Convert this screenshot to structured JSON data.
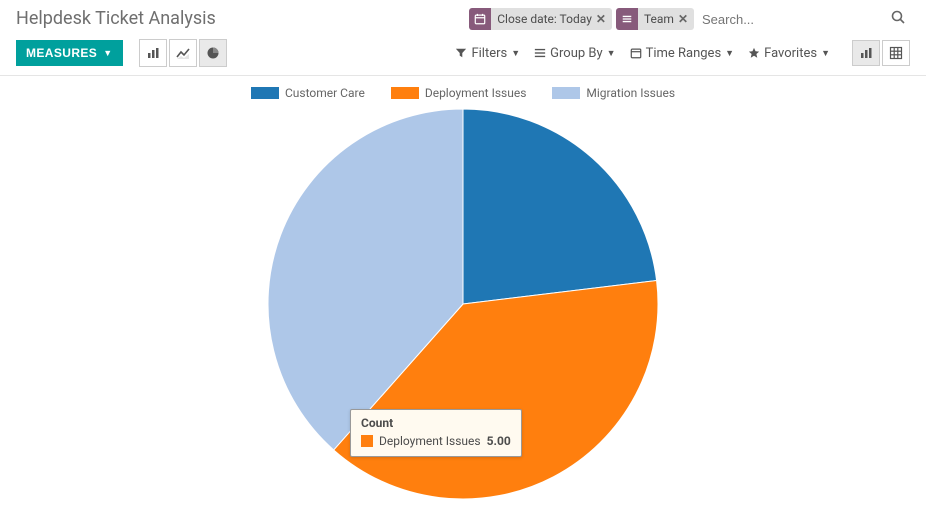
{
  "header": {
    "title": "Helpdesk Ticket Analysis"
  },
  "search": {
    "facets": [
      {
        "icon": "calendar",
        "label": "Close date: Today"
      },
      {
        "icon": "list",
        "label": "Team"
      }
    ],
    "placeholder": "Search..."
  },
  "toolbar": {
    "measures_label": "MEASURES",
    "filters_label": "Filters",
    "groupby_label": "Group By",
    "timeranges_label": "Time Ranges",
    "favorites_label": "Favorites"
  },
  "legend": {
    "items": [
      {
        "label": "Customer Care",
        "color": "#1f77b4"
      },
      {
        "label": "Deployment Issues",
        "color": "#ff7f0e"
      },
      {
        "label": "Migration Issues",
        "color": "#aec7e8"
      }
    ]
  },
  "tooltip": {
    "title": "Count",
    "series_label": "Deployment Issues",
    "value": "5.00",
    "color": "#ff7f0e"
  },
  "chart_data": {
    "type": "pie",
    "title": "Helpdesk Ticket Analysis",
    "measure": "Count",
    "group_by": "Team",
    "filter": "Close date: Today",
    "series": [
      {
        "name": "Customer Care",
        "value": 3.0,
        "color": "#1f77b4"
      },
      {
        "name": "Deployment Issues",
        "value": 5.0,
        "color": "#ff7f0e"
      },
      {
        "name": "Migration Issues",
        "value": 5.0,
        "color": "#aec7e8"
      }
    ]
  }
}
